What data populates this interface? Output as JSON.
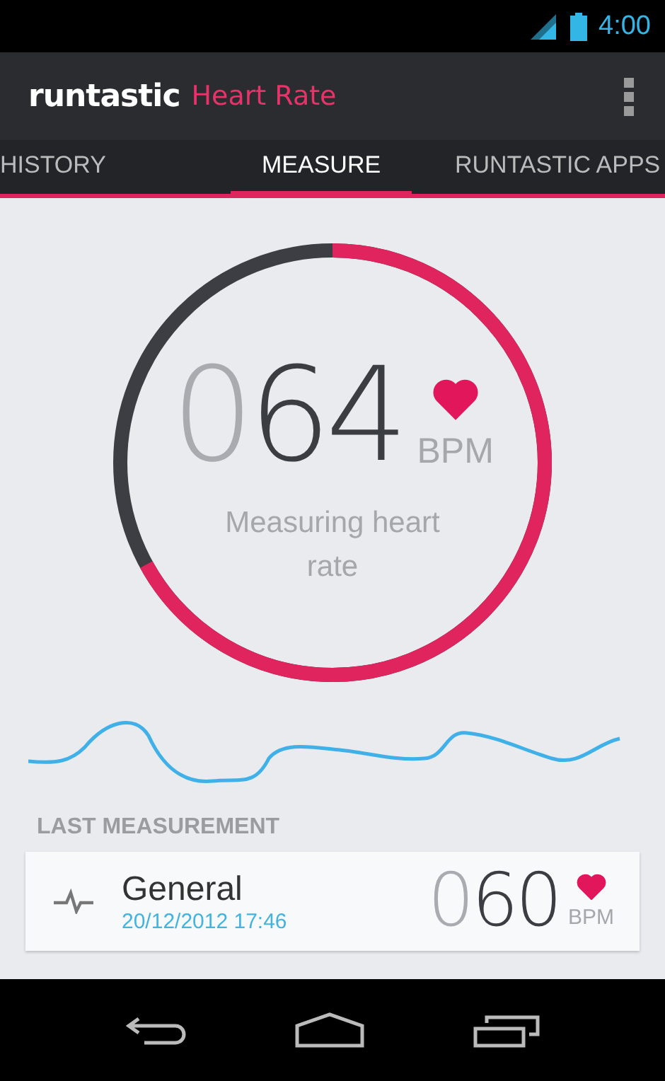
{
  "status_bar": {
    "time": "4:00"
  },
  "app_bar": {
    "logo": "runtastic",
    "title": "Heart Rate"
  },
  "tabs": [
    {
      "label": "HISTORY",
      "selected": false
    },
    {
      "label": "MEASURE",
      "selected": true
    },
    {
      "label": "RUNTASTIC APPS",
      "selected": false
    }
  ],
  "gauge": {
    "level": 0.67,
    "lead": "0",
    "value": "64",
    "unit": "BPM",
    "message": "Measuring heart rate"
  },
  "last_measurement": {
    "heading": "LAST MEASUREMENT",
    "name": "General",
    "date": "20/12/2012 17:46",
    "lead": "0",
    "value": "60",
    "unit": "BPM"
  }
}
